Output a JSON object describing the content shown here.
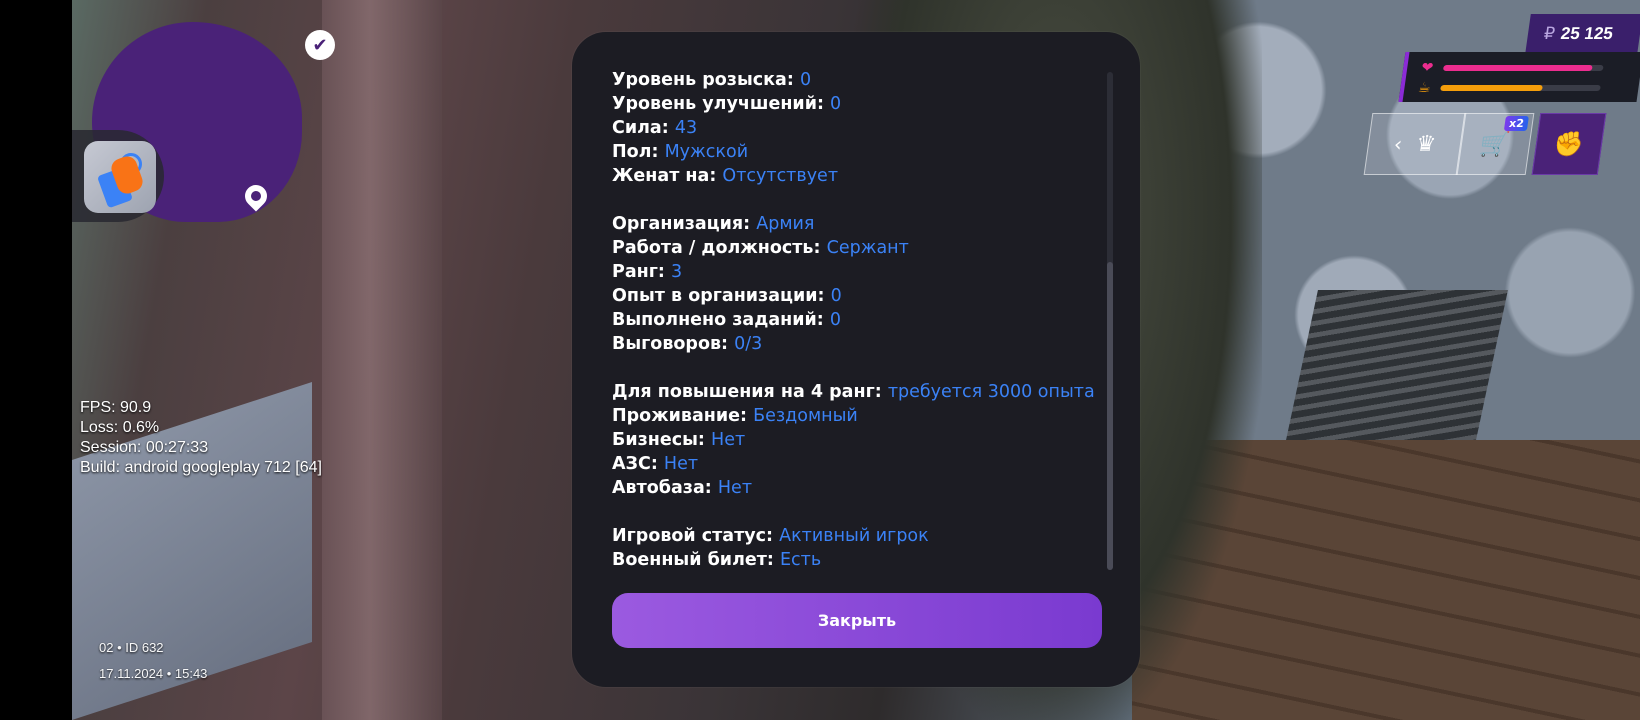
{
  "hud": {
    "money": "25 125",
    "currency_symbol": "₽",
    "health_fraction": 0.93,
    "hunger_fraction": 0.64,
    "cart_badge": "x2",
    "colors": {
      "accent": "#4a2278",
      "health": "#ec2d8f",
      "hunger": "#f59e0b",
      "value": "#3b82f6"
    }
  },
  "debug": {
    "fps": "FPS: 90.9",
    "loss": "Loss: 0.6%",
    "session": "Session:  00:27:33",
    "build": "Build: android googleplay 712 [64]"
  },
  "footer": {
    "server": "02 • ID 632",
    "datetime": "17.11.2024 • 15:43"
  },
  "dialog": {
    "rows": [
      {
        "label": "Уровень розыска:",
        "value": "0"
      },
      {
        "label": "Уровень улучшений:",
        "value": "0"
      },
      {
        "label": "Сила:",
        "value": "43"
      },
      {
        "label": "Пол:",
        "value": "Мужской"
      },
      {
        "label": "Женат на:",
        "value": "Отсутствует"
      },
      {
        "label": "Организация:",
        "value": "Армия"
      },
      {
        "label": "Работа / должность:",
        "value": "Сержант"
      },
      {
        "label": "Ранг:",
        "value": "3"
      },
      {
        "label": "Опыт в организации:",
        "value": "0"
      },
      {
        "label": "Выполнено заданий:",
        "value": "0"
      },
      {
        "label": "Выговоров:",
        "value": "0/3"
      },
      {
        "label": "Для повышения на 4 ранг:",
        "value": "требуется 3000 опыта"
      },
      {
        "label": "Проживание:",
        "value": "Бездомный"
      },
      {
        "label": "Бизнесы:",
        "value": "Нет"
      },
      {
        "label": "АЗС:",
        "value": "Нет"
      },
      {
        "label": "Автобаза:",
        "value": "Нет"
      },
      {
        "label": "Игровой статус:",
        "value": "Активный игрок"
      },
      {
        "label": "Военный билет:",
        "value": "Есть"
      }
    ],
    "close_label": "Закрыть"
  }
}
